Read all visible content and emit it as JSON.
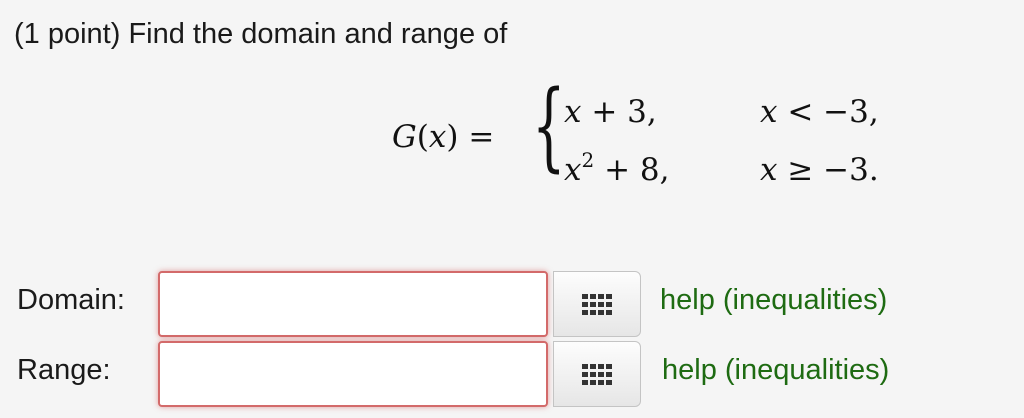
{
  "problem": {
    "prompt": "(1 point) Find the domain and range of"
  },
  "function": {
    "lhs_name": "G",
    "lhs_var": "x",
    "cases": [
      {
        "expr_var": "x",
        "expr_power": "",
        "expr_rest": " + 3,",
        "cond_var": "x",
        "cond_rest": " < −3,"
      },
      {
        "expr_var": "x",
        "expr_power": "2",
        "expr_rest": " + 8,",
        "cond_var": "x",
        "cond_rest": " ≥ −3."
      }
    ]
  },
  "answers": [
    {
      "label": "Domain:",
      "value": "",
      "help": "help (inequalities)",
      "palette_icon": "grid-icon"
    },
    {
      "label": "Range:",
      "value": "",
      "help": "help (inequalities)",
      "palette_icon": "grid-icon"
    }
  ],
  "colors": {
    "background": "#f5f5f5",
    "error_border": "#d36a6a",
    "help_link": "#1e6b12",
    "palette_glyph": "#333333"
  }
}
